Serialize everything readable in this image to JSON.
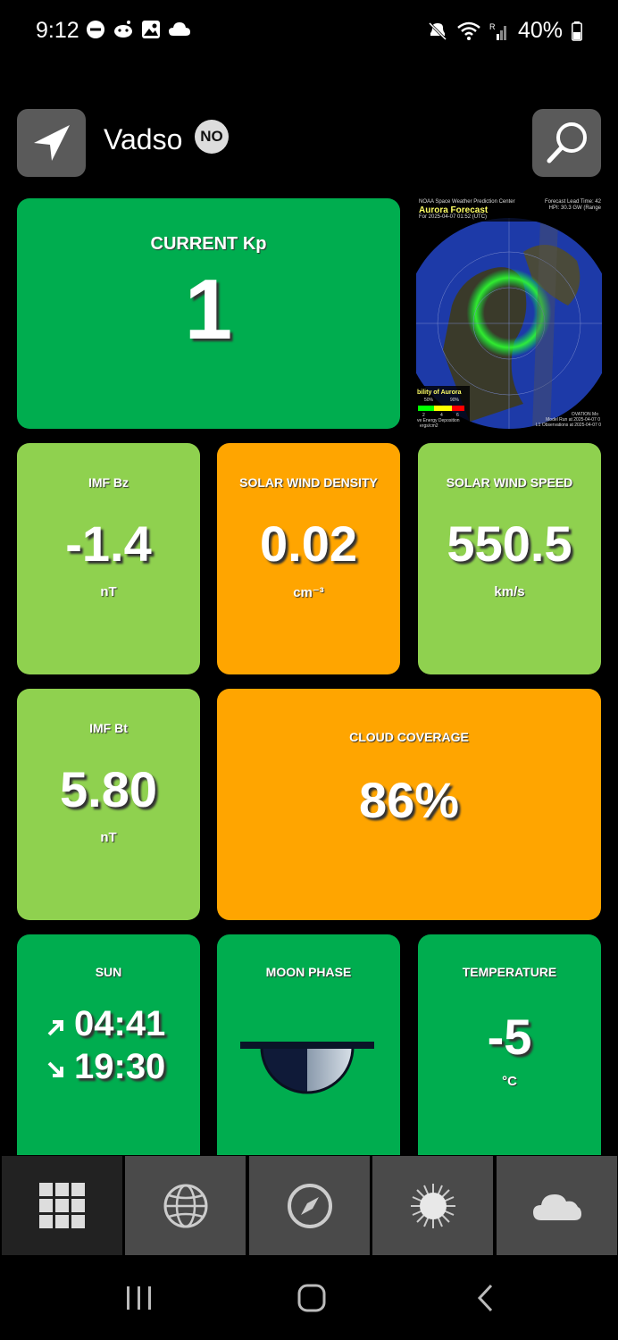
{
  "status_bar": {
    "time": "9:12",
    "battery": "40%"
  },
  "header": {
    "location": "Vadso",
    "country_code": "NO"
  },
  "tiles": {
    "kp": {
      "title": "CURRENT Kp",
      "value": "1"
    },
    "aurora_map": {
      "source": "NOAA Space Weather Prediction Center",
      "title": "Aurora Forecast",
      "subtitle": "For 2025-04-07 01:52 (UTC)",
      "lead_time": "Forecast Lead Time: 42",
      "power": "HPI: 30.3 GW (Range",
      "legend_title": "bility of Aurora",
      "legend_values": [
        "50%",
        "90%"
      ],
      "legend_ticks": [
        "2",
        "4",
        "6"
      ],
      "legend_caption1": "ve Energy Deposition",
      "legend_caption2": "ergs/cm2",
      "footer1": "OVATION Mo",
      "footer2": "Model Run at 2025-04-07 0",
      "footer3": "L1 Observations at 2025-04-07 0"
    },
    "imf_bz": {
      "title": "IMF Bz",
      "value": "-1.4",
      "unit": "nT"
    },
    "sw_density": {
      "title": "SOLAR WIND DENSITY",
      "value": "0.02",
      "unit": "cm⁻³"
    },
    "sw_speed": {
      "title": "SOLAR WIND SPEED",
      "value": "550.5",
      "unit": "km/s"
    },
    "imf_bt": {
      "title": "IMF Bt",
      "value": "5.80",
      "unit": "nT"
    },
    "cloud": {
      "title": "CLOUD COVERAGE",
      "value": "86%"
    },
    "sun": {
      "title": "SUN",
      "sunrise": "04:41",
      "sunset": "19:30"
    },
    "moon": {
      "title": "MOON PHASE"
    },
    "temperature": {
      "title": "TEMPERATURE",
      "value": "-5",
      "unit": "°C"
    }
  },
  "colors": {
    "green": "#00ad4f",
    "light_green": "#8fd14f",
    "orange": "#ffa500",
    "button_gray": "#5a5a5a"
  },
  "bottom_nav": {
    "tabs": [
      {
        "icon": "grid-icon",
        "active": true
      },
      {
        "icon": "globe-icon",
        "active": false
      },
      {
        "icon": "compass-icon",
        "active": false
      },
      {
        "icon": "sun-icon",
        "active": false
      },
      {
        "icon": "cloud-icon",
        "active": false
      }
    ]
  }
}
